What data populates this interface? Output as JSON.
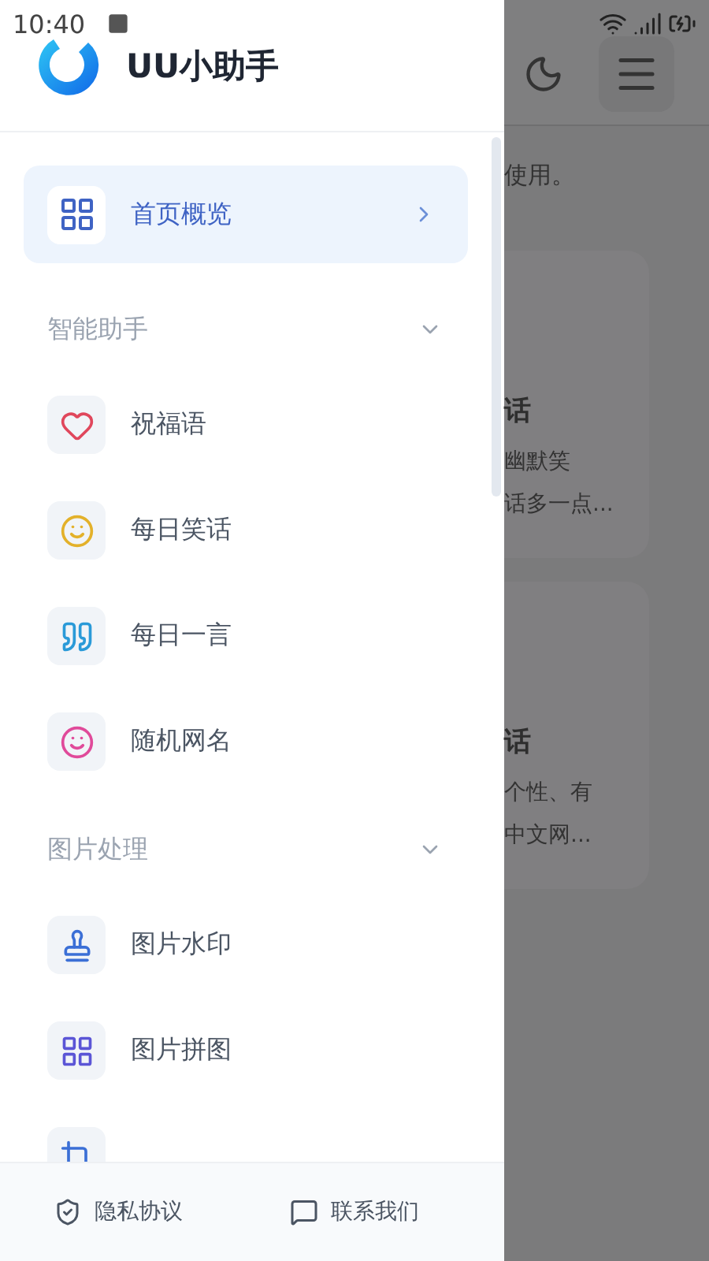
{
  "status_bar": {
    "time": "10:40"
  },
  "app": {
    "title": "UU小助手"
  },
  "nav": {
    "home": {
      "label": "首页概览",
      "selected": true
    },
    "sections": [
      {
        "title": "智能助手",
        "expanded": true,
        "items": [
          {
            "label": "祝福语",
            "color": "#e0475c"
          },
          {
            "label": "每日笑话",
            "color": "#e3b12a"
          },
          {
            "label": "每日一言",
            "color": "#2a9ad8"
          },
          {
            "label": "随机网名",
            "color": "#e04a9a"
          }
        ]
      },
      {
        "title": "图片处理",
        "expanded": true,
        "items": [
          {
            "label": "图片水印",
            "color": "#3b6fd6"
          },
          {
            "label": "图片拼图",
            "color": "#5b55d6"
          },
          {
            "color": "#3b6fd6"
          }
        ]
      }
    ]
  },
  "footer": [
    {
      "label": "隐私协议"
    },
    {
      "label": "联系我们"
    }
  ],
  "background": {
    "notice": "使用。",
    "cards": [
      {
        "title": "话",
        "lines": [
          "幽默笑",
          "话多一点..."
        ]
      },
      {
        "title": "话",
        "lines": [
          "个性、有",
          "中文网..."
        ]
      }
    ]
  }
}
